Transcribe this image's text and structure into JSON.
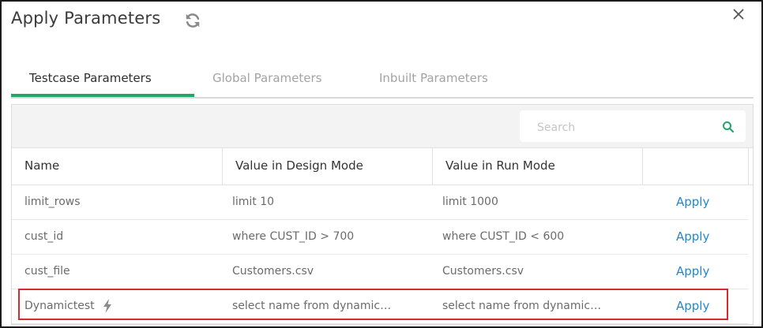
{
  "dialog": {
    "title": "Apply Parameters",
    "refresh_icon": "refresh-icon",
    "close_icon": "close-icon"
  },
  "tabs": [
    {
      "label": "Testcase Parameters",
      "active": true
    },
    {
      "label": "Global Parameters",
      "active": false
    },
    {
      "label": "Inbuilt Parameters",
      "active": false
    }
  ],
  "search": {
    "placeholder": "Search",
    "value": "",
    "icon": "search-icon"
  },
  "table": {
    "columns": [
      "Name",
      "Value in Design Mode",
      "Value in Run Mode",
      ""
    ],
    "rows": [
      {
        "name": "limit_rows",
        "design": "limit 10",
        "run": "limit 1000",
        "action": "Apply"
      },
      {
        "name": "cust_id",
        "design": "where CUST_ID > 700",
        "run": "where CUST_ID < 600",
        "action": "Apply"
      },
      {
        "name": "cust_file",
        "design": "Customers.csv",
        "run": "Customers.csv",
        "action": "Apply"
      },
      {
        "name": "Dynamictest",
        "design": "select name from dynamic…",
        "run": "select name from dynamic…",
        "action": "Apply",
        "icon": "lightning-icon",
        "highlighted": true
      }
    ]
  },
  "colors": {
    "accent": "#21a66b",
    "link": "#1f88d6",
    "highlight": "#d62c2c"
  }
}
